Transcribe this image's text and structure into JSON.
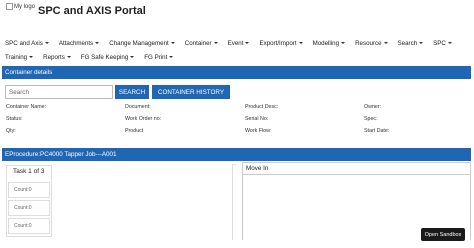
{
  "logo": {
    "alt_text": "My logo"
  },
  "app": {
    "title": "SPC and AXIS Portal"
  },
  "nav": {
    "row1": [
      {
        "label": "SPC and Axis"
      },
      {
        "label": "Attachments"
      },
      {
        "label": "Change Management"
      },
      {
        "label": "Container"
      },
      {
        "label": "Event"
      },
      {
        "label": "Export/Import"
      },
      {
        "label": "Modelling"
      },
      {
        "label": "Resource"
      },
      {
        "label": "Search"
      },
      {
        "label": "SPC"
      }
    ],
    "row2": [
      {
        "label": "Training"
      },
      {
        "label": "Reports"
      },
      {
        "label": "FG Safe Keeping"
      },
      {
        "label": "FG Print"
      }
    ]
  },
  "container_details": {
    "header": "Container details",
    "search_placeholder": "Search",
    "search_button": "SEARCH",
    "history_button": "CONTAINER HISTORY",
    "fields": {
      "container_name": "Container Name:",
      "document": "Document:",
      "product_desc": "Product Desc:",
      "owner": "Owner:",
      "status": "Status:",
      "work_order_no": "Work Order no:",
      "serial_no": "Serial No:",
      "spec": "Spec:",
      "qty": "Qty:",
      "product": "Product",
      "work_flow": "Work Flow:",
      "start_date": "Start Date:"
    }
  },
  "procedure": {
    "header": "EProcedure:PC4000 Tapper Job---A001",
    "task_title": "Task 1 of 3",
    "counts": [
      "Count:0",
      "Count:0",
      "Count:0"
    ],
    "move_in": "Move In"
  },
  "sandbox": {
    "label": "Open Sandbox"
  }
}
